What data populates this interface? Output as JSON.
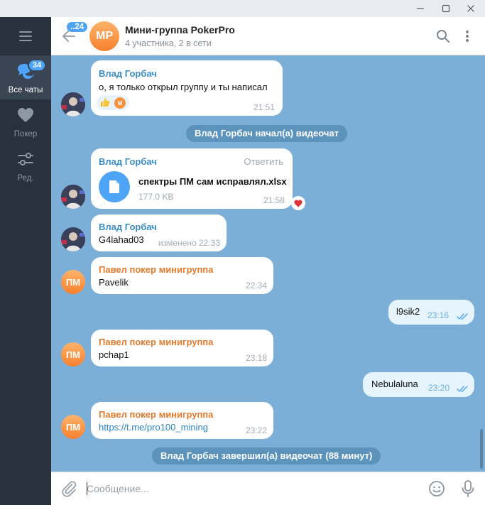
{
  "window": {
    "controls": [
      "minimize-icon",
      "maximize-icon",
      "close-icon"
    ]
  },
  "sidebar": {
    "menu_icon": "hamburger-icon",
    "folders": [
      {
        "label": "Все чаты",
        "badge": "34",
        "icon": "chats-icon",
        "active": true
      },
      {
        "label": "Покер",
        "icon": "heart-icon",
        "active": false
      },
      {
        "label": "Ред.",
        "icon": "sliders-icon",
        "active": false
      }
    ]
  },
  "header": {
    "back_badge": "..24",
    "avatar_initials": "MP",
    "title": "Мини-группа PokerPro",
    "status": "4 участника, 2 в сети"
  },
  "messages": {
    "m1": {
      "sender": "Влад Горбач",
      "text": "о, я только открыл группу и ты написал",
      "time": "21:51",
      "reactions": [
        "thumbs-up-icon",
        "reaction-avatar-icon"
      ]
    },
    "s1": {
      "text": "Влад Горбач начал(а) видеочат"
    },
    "m2": {
      "sender": "Влад Горбач",
      "reply_label": "Ответить",
      "file_name": "спектры ПМ сам исправлял.xlsx",
      "file_size": "177.0 KB",
      "time": "21:58",
      "reaction": "heart-reaction-icon"
    },
    "m3": {
      "sender": "Влад Горбач",
      "text": "G4lahad03",
      "time": "изменено 22:33"
    },
    "m4": {
      "sender": "Павел покер минигруппа",
      "avatar": "ПМ",
      "text": "Pavelik",
      "time": "22:34"
    },
    "m5": {
      "text": "l9sik2",
      "time": "23:16"
    },
    "m6": {
      "sender": "Павел покер минигруппа",
      "avatar": "ПМ",
      "text": "pchap1",
      "time": "23:18"
    },
    "m7": {
      "text": "Nebulaluna",
      "time": "23:20"
    },
    "m8": {
      "sender": "Павел покер минигруппа",
      "avatar": "ПМ",
      "text": "https://t.me/pro100_mining",
      "time": "23:22"
    },
    "s2": {
      "text": "Влад Горбач завершил(а) видеочат (88 минут)"
    }
  },
  "composer": {
    "placeholder": "Сообщение...",
    "icons": [
      "attach-icon",
      "emoji-icon",
      "mic-icon"
    ]
  },
  "colors": {
    "accent": "#4ea4f6",
    "sidebar": "#28313d",
    "chat_bg": "#7bafd8",
    "sender_blue": "#3a8ec8",
    "sender_orange": "#e37a2c"
  }
}
